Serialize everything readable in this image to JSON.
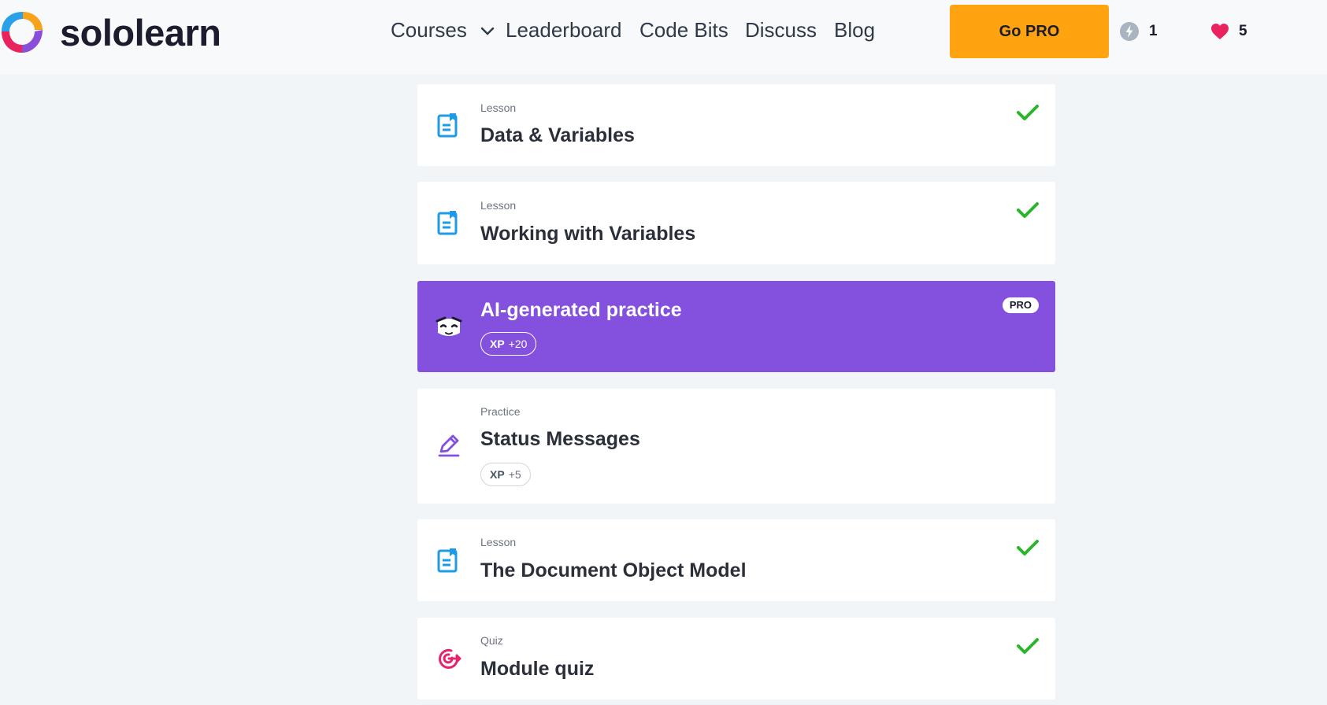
{
  "header": {
    "logo_text": "sololearn",
    "nav": {
      "courses": "Courses",
      "leaderboard": "Leaderboard",
      "code_bits": "Code Bits",
      "discuss": "Discuss",
      "blog": "Blog"
    },
    "go_pro_label": "Go PRO",
    "streak_count": "1",
    "hearts_count": "5"
  },
  "items": [
    {
      "kind": "Lesson",
      "title": "Data & Variables",
      "completed": true,
      "icon": "lesson-icon"
    },
    {
      "kind": "Lesson",
      "title": "Working with Variables",
      "completed": true,
      "icon": "lesson-icon"
    },
    {
      "kind": "",
      "title": "AI-generated practice",
      "badge": "PRO",
      "xp_label": "XP",
      "xp_value": "+20",
      "icon": "ai-bot-icon"
    },
    {
      "kind": "Practice",
      "title": "Status Messages",
      "xp_label": "XP",
      "xp_value": "+5",
      "icon": "practice-pencil-icon"
    },
    {
      "kind": "Lesson",
      "title": "The Document Object Model",
      "completed": true,
      "icon": "lesson-icon"
    },
    {
      "kind": "Quiz",
      "title": "Module quiz",
      "completed": true,
      "icon": "quiz-target-icon"
    }
  ],
  "colors": {
    "accent_purple": "#8450de",
    "go_pro_orange": "#ffa310",
    "check_green": "#2bb52b",
    "lesson_blue": "#1d9be6",
    "quiz_pink": "#e6236e"
  }
}
